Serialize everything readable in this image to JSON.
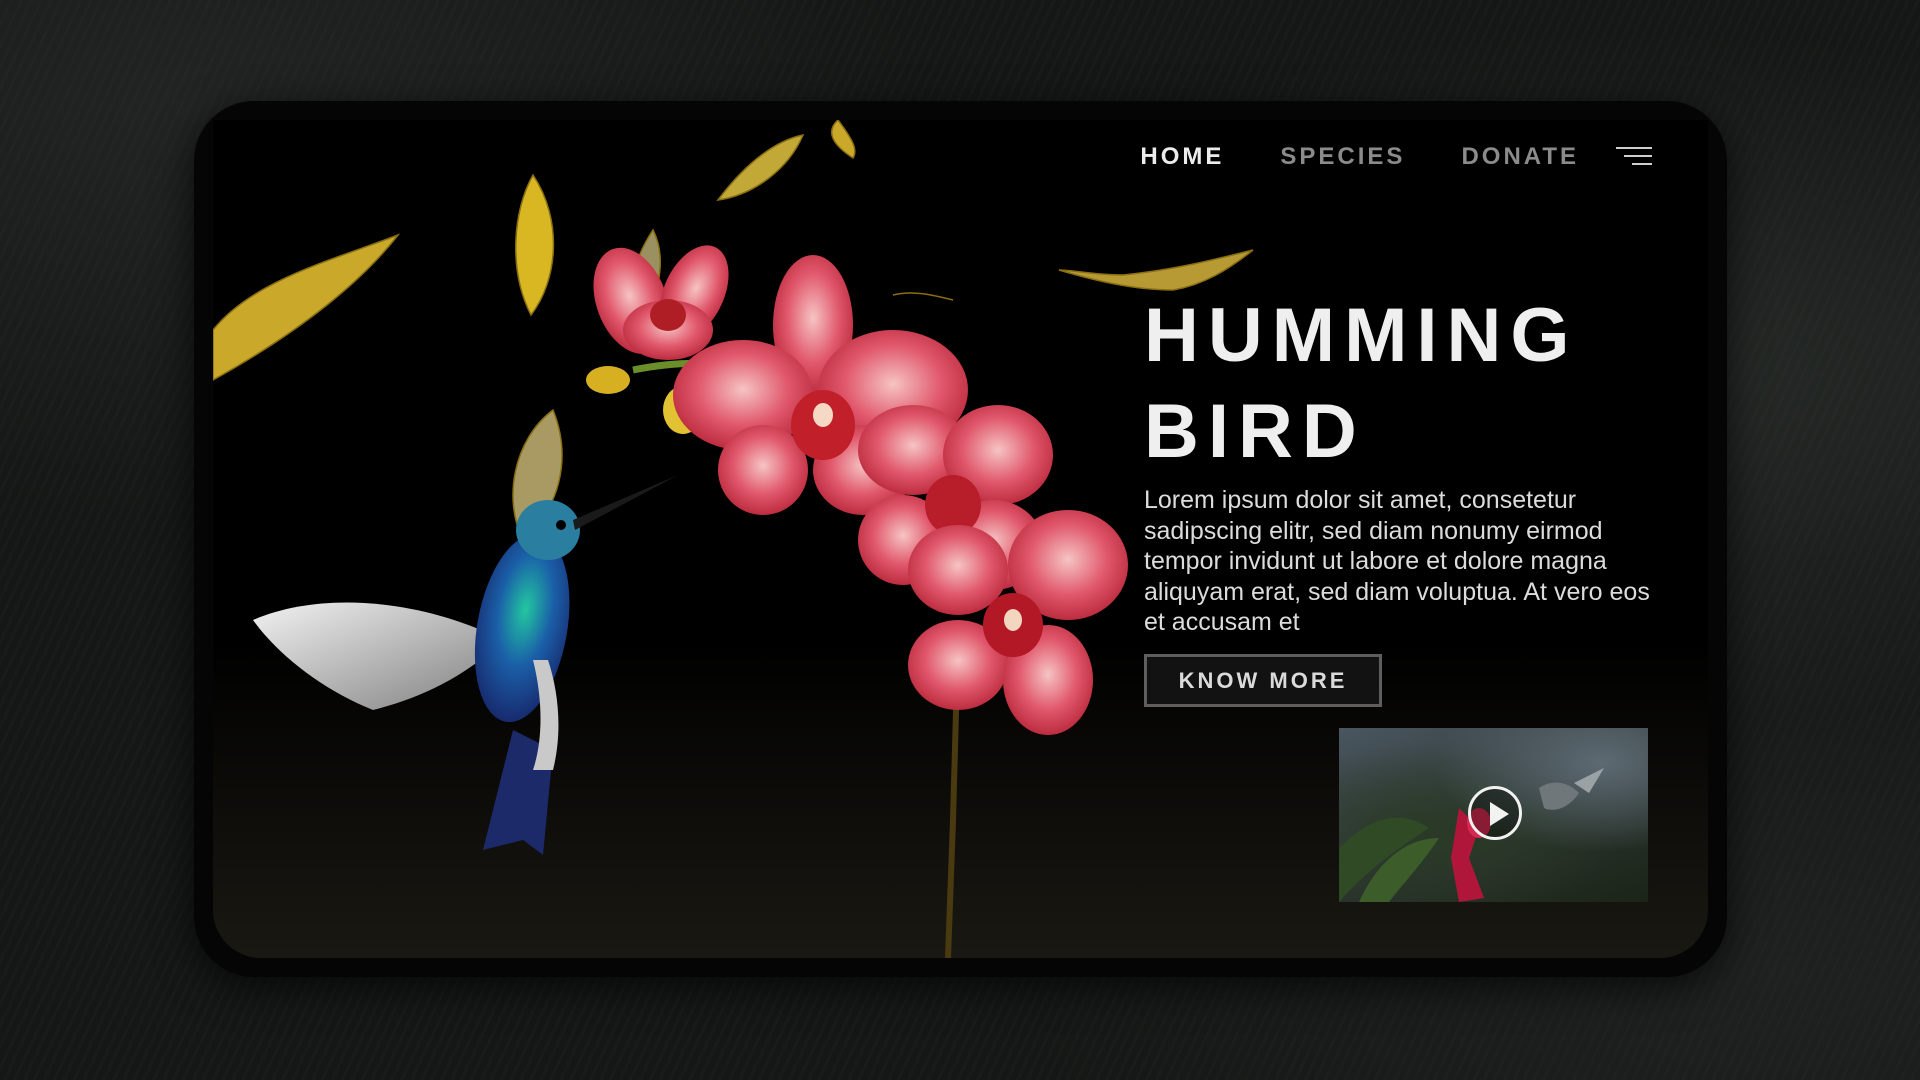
{
  "nav": {
    "items": [
      {
        "label": "HOME",
        "active": true
      },
      {
        "label": "SPECIES",
        "active": false
      },
      {
        "label": "DONATE",
        "active": false
      }
    ],
    "menu_icon": "hamburger-menu-icon"
  },
  "hero": {
    "title_line1": "HUMMING",
    "title_line2": "BIRD",
    "description": "Lorem ipsum dolor sit amet, consetetur sadipscing elitr, sed diam nonumy eirmod tempor invidunt ut labore et dolore magna aliquyam erat, sed diam voluptua. At vero eos et accusam et",
    "cta_label": "KNOW MORE"
  },
  "video": {
    "play_icon": "play-icon"
  },
  "colors": {
    "background": "#000000",
    "text": "#efefef",
    "nav_inactive": "#8b8b8b",
    "orchid": "#e0566a",
    "leaf": "#c9a82a"
  }
}
